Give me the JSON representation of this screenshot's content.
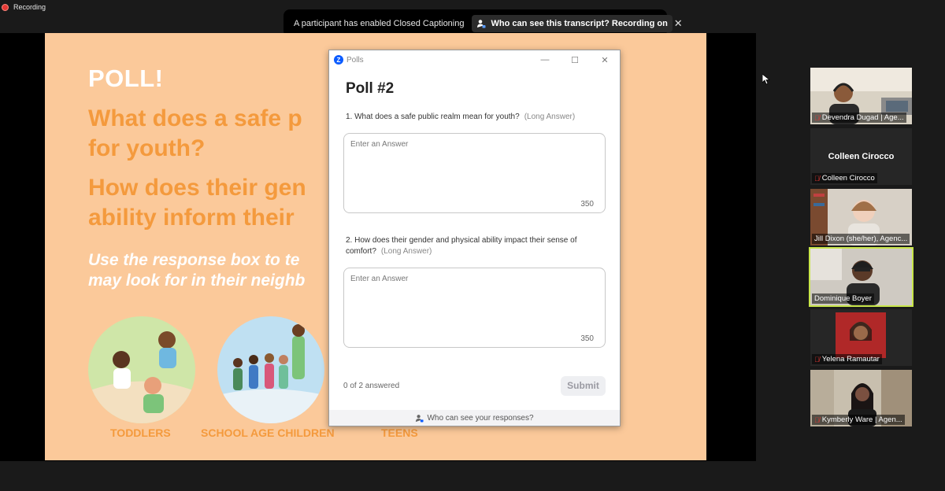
{
  "recording": {
    "label": "Recording"
  },
  "caption_bar": {
    "message": "A participant has enabled Closed Captioning",
    "transcript_button": "Who can see this transcript? Recording on",
    "close": "✕"
  },
  "slide": {
    "poll_heading": "POLL!",
    "question1": "What does a safe p\nfor youth?",
    "question2": "How does their gen\nability inform their",
    "instruction": "Use the response box to te\nmay look for in their neighb",
    "groups": [
      "TODDLERS",
      "SCHOOL AGE CHILDREN",
      "TEENS"
    ]
  },
  "poll_window": {
    "app_name": "Polls",
    "controls": {
      "minimize": "—",
      "maximize": "☐",
      "close": "✕"
    },
    "title": "Poll #2",
    "questions": [
      {
        "text": "1. What does a safe public realm mean for youth?",
        "type": "(Long Answer)",
        "placeholder": "Enter an Answer",
        "char_limit": "350"
      },
      {
        "text": "2. How does their gender and physical ability impact their sense of comfort?",
        "type": "(Long Answer)",
        "placeholder": "Enter an Answer",
        "char_limit": "350"
      }
    ],
    "progress": "0 of 2 answered",
    "submit_label": "Submit",
    "privacy_link": "Who can see your responses?"
  },
  "participants": [
    {
      "name": "Devendra Dugad | Age...",
      "muted": true,
      "video": true
    },
    {
      "name": "Colleen Cirocco",
      "display_name": "Colleen Cirocco",
      "muted": true,
      "video": false
    },
    {
      "name": "Jill Dixon (she/her), Agenc...",
      "muted": false,
      "video": true
    },
    {
      "name": "Dominique Boyer",
      "muted": false,
      "video": true,
      "speaking": true
    },
    {
      "name": "Yelena Ramautar",
      "muted": true,
      "video": true
    },
    {
      "name": "Kymberly Ware | Agen...",
      "muted": true,
      "video": true
    }
  ],
  "colors": {
    "slide_bg": "#fbc99a",
    "slide_accent": "#f49a3d",
    "zoom_blue": "#0b5cff",
    "active_speaker": "#c8e64a",
    "muted_red": "#e53935"
  }
}
